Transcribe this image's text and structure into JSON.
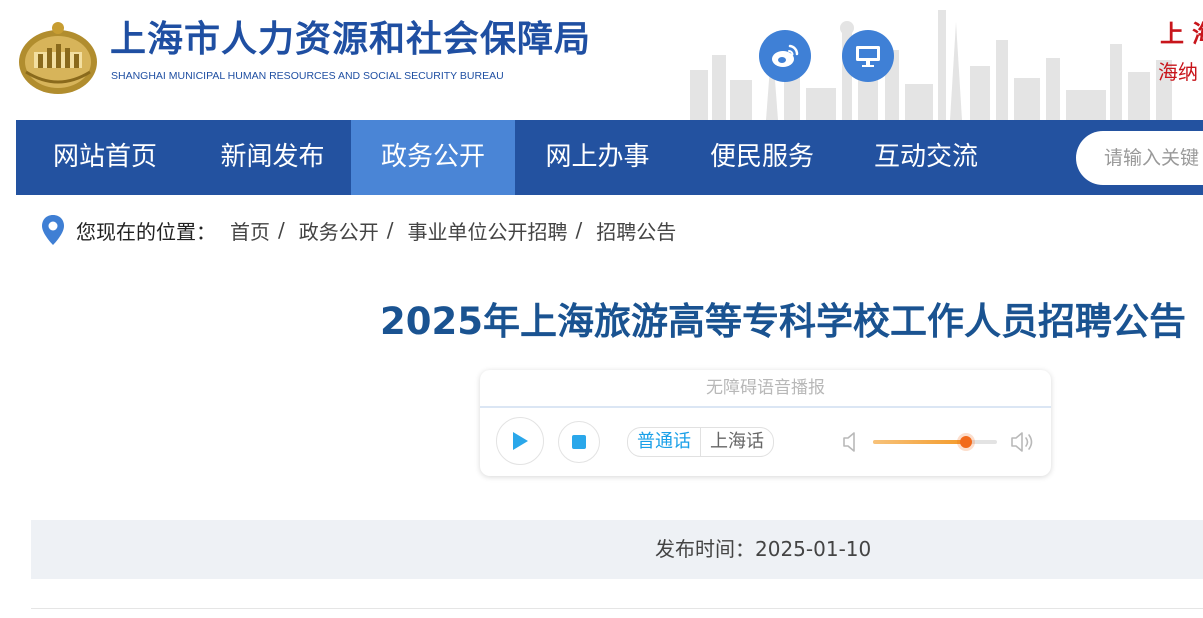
{
  "header": {
    "title_cn": "上海市人力资源和社会保障局",
    "title_en": "SHANGHAI MUNICIPAL HUMAN RESOURCES AND SOCIAL SECURITY BUREAU",
    "logo_icon": "bureau-emblem-icon",
    "weibo_icon": "weibo-icon",
    "desktop_icon": "monitor-icon",
    "corner_text_1": "上海",
    "corner_text_2": "海纳"
  },
  "nav": {
    "items": [
      {
        "label": "网站首页"
      },
      {
        "label": "新闻发布"
      },
      {
        "label": "政务公开",
        "active": true
      },
      {
        "label": "网上办事"
      },
      {
        "label": "便民服务"
      },
      {
        "label": "互动交流"
      }
    ],
    "search_placeholder": "请输入关键"
  },
  "breadcrumb": {
    "location_icon": "location-pin-icon",
    "label": "您现在的位置：",
    "items": [
      "首页",
      "政务公开",
      "事业单位公开招聘",
      "招聘公告"
    ],
    "separator": "/"
  },
  "article": {
    "title": "2025年上海旅游高等专科学校工作人员招聘公告",
    "publish_label": "发布时间：",
    "publish_date": "2025-01-10"
  },
  "player": {
    "header": "无障碍语音播报",
    "play_icon": "play-icon",
    "stop_icon": "stop-icon",
    "languages": [
      "普通话",
      "上海话"
    ],
    "selected_language": "普通话",
    "volume_low_icon": "volume-low-icon",
    "volume_high_icon": "volume-high-icon",
    "volume_level": 0.75
  },
  "colors": {
    "brand_blue": "#2352a0",
    "nav_active": "#4a85d6",
    "title_blue": "#1a5391",
    "accent_red": "#c8151b",
    "slider_orange": "#f26a1b"
  }
}
